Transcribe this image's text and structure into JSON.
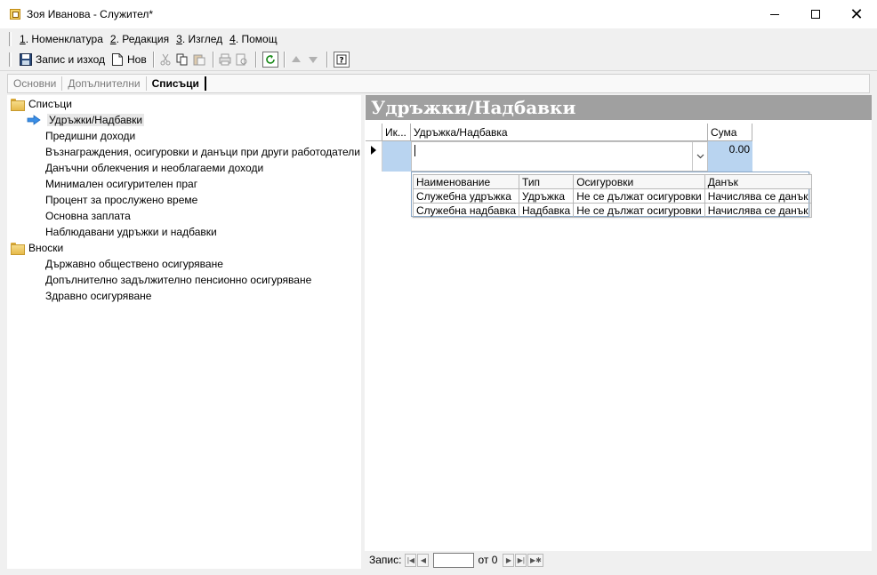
{
  "window": {
    "title": "Зоя Иванова - Служител*",
    "controls": {
      "minimize": "minimize-icon",
      "maximize": "maximize-icon",
      "close": "✕"
    }
  },
  "menu": {
    "items": [
      {
        "key": "1",
        "label": ". Номенклатура"
      },
      {
        "key": "2",
        "label": ". Редакция"
      },
      {
        "key": "3",
        "label": ". Изглед"
      },
      {
        "key": "4",
        "label": ". Помощ"
      }
    ]
  },
  "toolbar": {
    "save_exit_label": "Запис и изход",
    "new_label": "Нов"
  },
  "tabs": [
    {
      "label": "Основни",
      "active": false
    },
    {
      "label": "Допълнителни",
      "active": false
    },
    {
      "label": "Списъци",
      "active": true
    }
  ],
  "tree": {
    "groups": [
      {
        "label": "Списъци",
        "children": [
          {
            "label": "Удръжки/Надбавки",
            "selected": true
          },
          {
            "label": "Предишни доходи"
          },
          {
            "label": "Възнаграждения, осигуровки и данъци при други работодатели"
          },
          {
            "label": "Данъчни облекчения и необлагаеми доходи"
          },
          {
            "label": "Минимален осигурителен праг"
          },
          {
            "label": "Процент за прослужено време"
          },
          {
            "label": "Основна заплата"
          },
          {
            "label": "Наблюдавани удръжки и надбавки"
          }
        ]
      },
      {
        "label": "Вноски",
        "children": [
          {
            "label": "Държавно обществено осигуряване"
          },
          {
            "label": "Допълнително задължително пенсионно осигуряване"
          },
          {
            "label": "Здравно осигуряване"
          }
        ]
      }
    ]
  },
  "panel": {
    "header": "Удръжки/Надбавки",
    "grid": {
      "columns": [
        "Ик...",
        "Удръжка/Надбавка",
        "Сума"
      ],
      "row": {
        "amount": "0.00"
      }
    },
    "dropdown": {
      "columns": [
        "Наименование",
        "Тип",
        "Осигуровки",
        "Данък"
      ],
      "rows": [
        [
          "Служебна удръжка",
          "Удръжка",
          "Не се дължат осигуровки",
          "Начислява се данък"
        ],
        [
          "Служебна надбавка",
          "Надбавка",
          "Не се дължат осигуровки",
          "Начислява се данък"
        ]
      ]
    }
  },
  "navigator": {
    "record_label": "Запис:",
    "of_label": "от 0",
    "record_value": ""
  },
  "colors": {
    "header_bg": "#a0a0a0",
    "cell_selected": "#b9d4f0"
  }
}
